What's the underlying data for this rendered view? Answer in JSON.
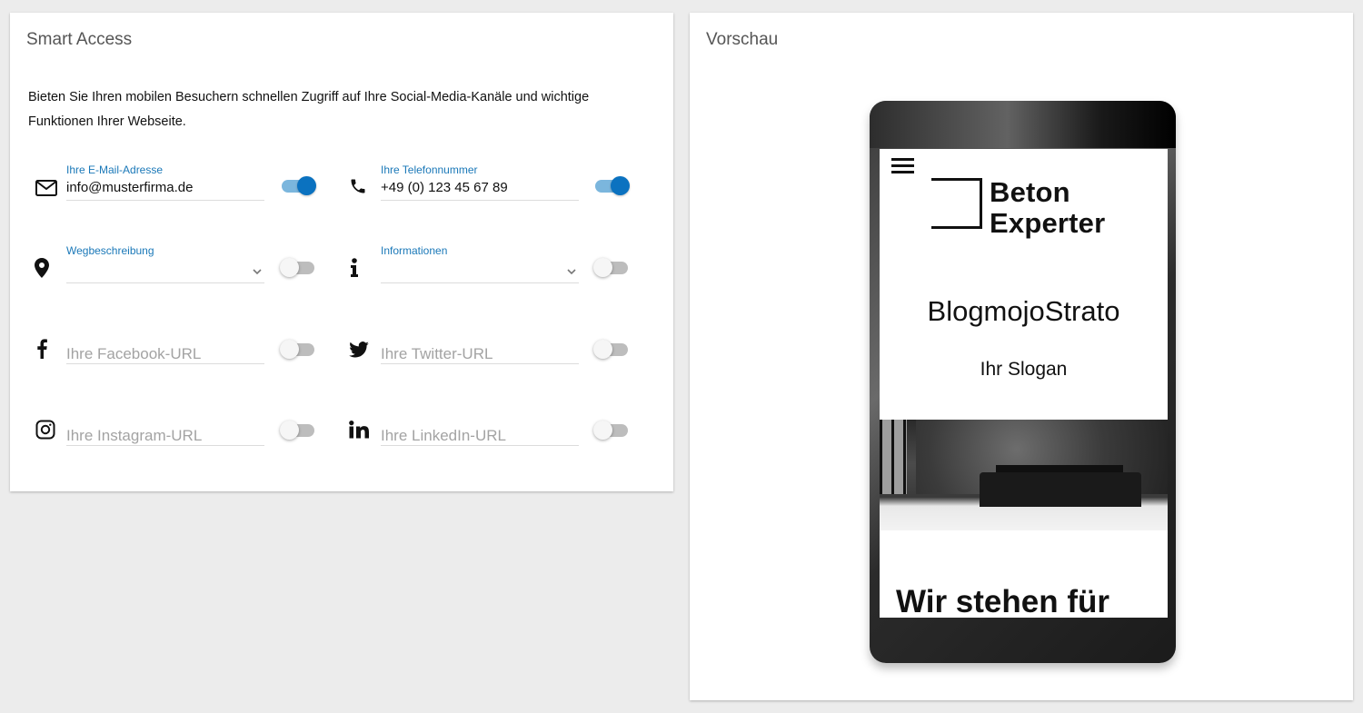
{
  "left_card": {
    "title": "Smart Access",
    "intro": "Bieten Sie Ihren mobilen Besuchern schnellen Zugriff auf Ihre Social-Media-Kanäle und wichtige Funktionen Ihrer Webseite.",
    "fields": {
      "email": {
        "icon": "envelope-icon",
        "label": "Ihre E-Mail-Adresse",
        "value": "info@musterfirma.de",
        "enabled": true
      },
      "phone": {
        "icon": "phone-icon",
        "label": "Ihre Telefonnummer",
        "value": "+49 (0) 123 45 67 89",
        "enabled": true
      },
      "directions": {
        "icon": "map-pin-icon",
        "label": "Wegbeschreibung",
        "value": "",
        "enabled": false
      },
      "information": {
        "icon": "info-icon",
        "label": "Informationen",
        "value": "",
        "enabled": false
      },
      "facebook": {
        "icon": "facebook-icon",
        "placeholder": "Ihre Facebook-URL",
        "enabled": false
      },
      "twitter": {
        "icon": "twitter-icon",
        "placeholder": "Ihre Twitter-URL",
        "enabled": false
      },
      "instagram": {
        "icon": "instagram-icon",
        "placeholder": "Ihre Instagram-URL",
        "enabled": false
      },
      "linkedin": {
        "icon": "linkedin-icon",
        "placeholder": "Ihre LinkedIn-URL",
        "enabled": false
      }
    }
  },
  "right_card": {
    "title": "Vorschau",
    "preview": {
      "logo_text": "Beton Experter",
      "site_title": "BlogmojoStrato",
      "slogan": "Ihr Slogan",
      "headline": "Wir stehen für"
    }
  },
  "colors": {
    "accent": "#1a78b8",
    "toggle_on": "#0b72c0",
    "toggle_track_on": "#7bb6dd",
    "toggle_off_track": "#bdbdbd",
    "background": "#ececec"
  }
}
